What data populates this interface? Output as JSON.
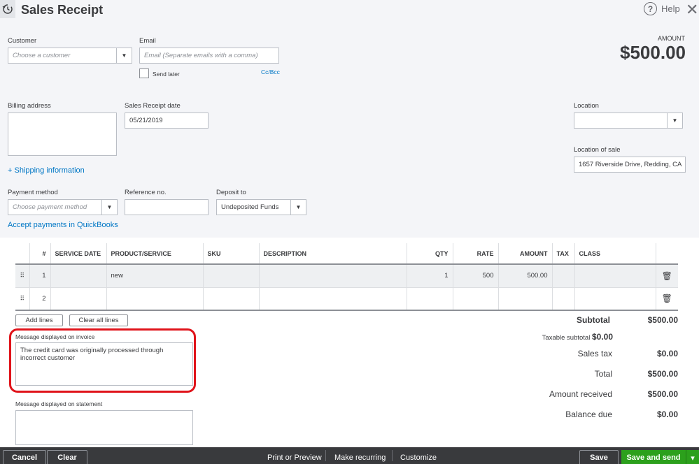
{
  "header": {
    "title": "Sales Receipt",
    "help_label": "Help",
    "help_symbol": "?",
    "close_symbol": "✕",
    "amount_label": "AMOUNT",
    "amount_value": "$500.00"
  },
  "form": {
    "customer_label": "Customer",
    "customer_placeholder": "Choose a customer",
    "email_label": "Email",
    "email_placeholder": "Email (Separate emails with a comma)",
    "send_later_label": "Send later",
    "cc_bcc_label": "Cc/Bcc",
    "billing_address_label": "Billing address",
    "receipt_date_label": "Sales Receipt date",
    "receipt_date_value": "05/21/2019",
    "location_label": "Location",
    "location_of_sale_label": "Location of sale",
    "location_of_sale_value": "1657 Riverside Drive, Redding, CA",
    "shipping_link": "+ Shipping information",
    "payment_method_label": "Payment method",
    "payment_method_placeholder": "Choose payment method",
    "reference_label": "Reference no.",
    "deposit_label": "Deposit to",
    "deposit_value": "Undeposited Funds",
    "accept_payments_link": "Accept payments in QuickBooks"
  },
  "table": {
    "columns": {
      "num": "#",
      "service_date": "SERVICE DATE",
      "product": "PRODUCT/SERVICE",
      "sku": "SKU",
      "description": "DESCRIPTION",
      "qty": "QTY",
      "rate": "RATE",
      "amount": "AMOUNT",
      "tax": "TAX",
      "class": "CLASS"
    },
    "rows": [
      {
        "num": "1",
        "service_date": "",
        "product": "new",
        "sku": "",
        "description": "",
        "qty": "1",
        "rate": "500",
        "amount": "500.00",
        "tax": "",
        "class": ""
      },
      {
        "num": "2",
        "service_date": "",
        "product": "",
        "sku": "",
        "description": "",
        "qty": "",
        "rate": "",
        "amount": "",
        "tax": "",
        "class": ""
      }
    ],
    "drag_symbol": "⠿",
    "trash_symbol": "🗑",
    "add_lines_label": "Add lines",
    "clear_lines_label": "Clear all lines"
  },
  "messages": {
    "invoice_label": "Message displayed on invoice",
    "invoice_text": "The credit card was originally processed through incorrect customer",
    "statement_label": "Message displayed on statement"
  },
  "totals": {
    "subtotal_label": "Subtotal",
    "subtotal_value": "$500.00",
    "taxable_label": "Taxable subtotal",
    "taxable_value": "$0.00",
    "sales_tax_label": "Sales tax",
    "sales_tax_value": "$0.00",
    "total_label": "Total",
    "total_value": "$500.00",
    "received_label": "Amount received",
    "received_value": "$500.00",
    "balance_label": "Balance due",
    "balance_value": "$0.00"
  },
  "footer": {
    "cancel": "Cancel",
    "clear": "Clear",
    "print_preview": "Print or Preview",
    "make_recurring": "Make recurring",
    "customize": "Customize",
    "save": "Save",
    "save_and_send": "Save and send",
    "dropdown_symbol": "▾"
  },
  "colors": {
    "link": "#0077c5",
    "save_send_green": "#2ca01c",
    "footer_bg": "#393a3d",
    "highlight_red": "#e0131a"
  }
}
